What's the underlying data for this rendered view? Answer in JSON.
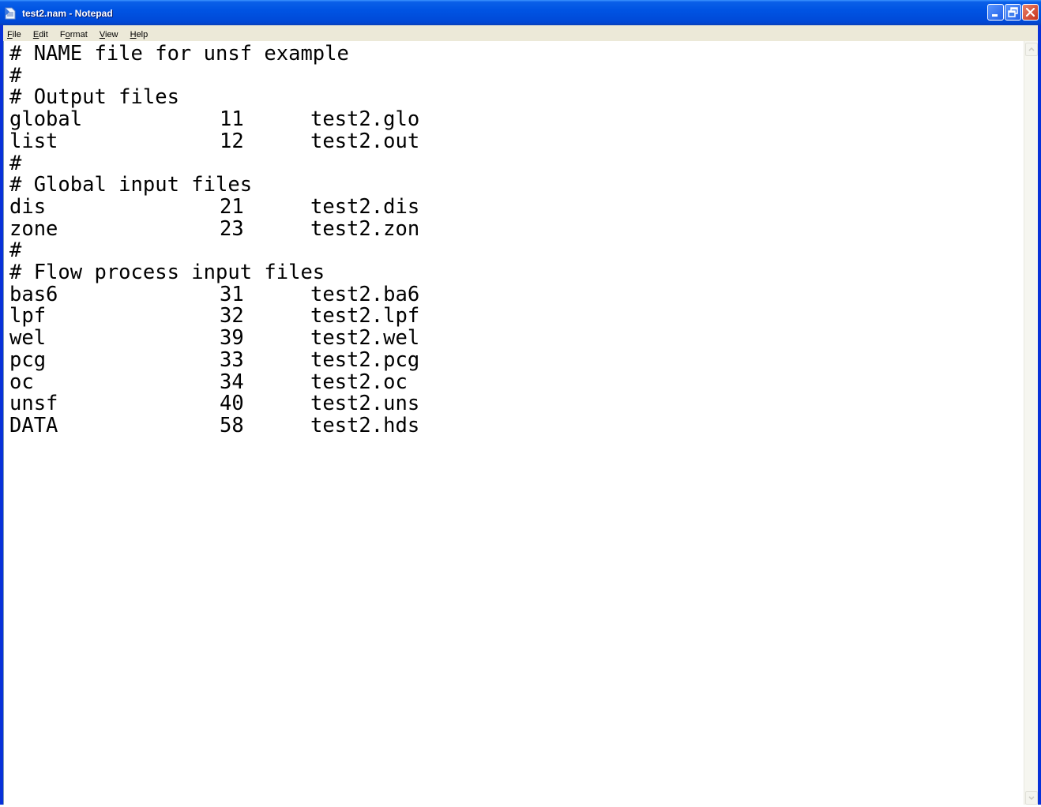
{
  "window": {
    "title": "test2.nam - Notepad"
  },
  "menu": [
    {
      "pre": "",
      "acc": "F",
      "post": "ile"
    },
    {
      "pre": "",
      "acc": "E",
      "post": "dit"
    },
    {
      "pre": "F",
      "acc": "o",
      "post": "rmat"
    },
    {
      "pre": "",
      "acc": "V",
      "post": "iew"
    },
    {
      "pre": "",
      "acc": "H",
      "post": "elp"
    }
  ],
  "document": {
    "lines": [
      {
        "a": "# NAME file for unsf example",
        "b": "",
        "c": ""
      },
      {
        "a": "#",
        "b": "",
        "c": ""
      },
      {
        "a": "# Output files",
        "b": "",
        "c": ""
      },
      {
        "a": "global",
        "b": "11",
        "c": "test2.glo"
      },
      {
        "a": "list",
        "b": "12",
        "c": "test2.out"
      },
      {
        "a": "#",
        "b": "",
        "c": ""
      },
      {
        "a": "# Global input files",
        "b": "",
        "c": ""
      },
      {
        "a": "dis",
        "b": "21",
        "c": "test2.dis"
      },
      {
        "a": "zone",
        "b": "23",
        "c": "test2.zon"
      },
      {
        "a": "#",
        "b": "",
        "c": ""
      },
      {
        "a": "# Flow process input files",
        "b": "",
        "c": ""
      },
      {
        "a": "bas6",
        "b": "31",
        "c": "test2.ba6"
      },
      {
        "a": "lpf",
        "b": "32",
        "c": "test2.lpf"
      },
      {
        "a": "wel",
        "b": "39",
        "c": "test2.wel"
      },
      {
        "a": "pcg",
        "b": "33",
        "c": "test2.pcg"
      },
      {
        "a": "oc",
        "b": "34",
        "c": "test2.oc"
      },
      {
        "a": "unsf",
        "b": "40",
        "c": "test2.uns"
      },
      {
        "a": "DATA",
        "b": "58",
        "c": "test2.hds"
      }
    ]
  }
}
